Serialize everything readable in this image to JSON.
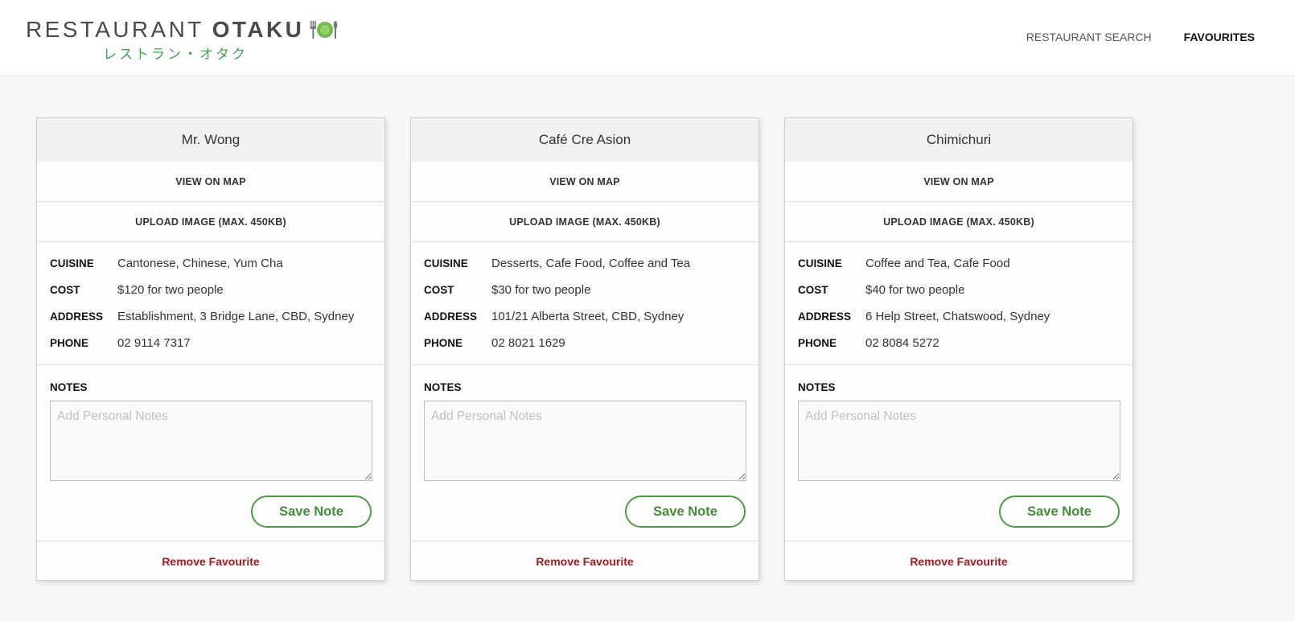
{
  "app": {
    "logo_light": "RESTAURANT",
    "logo_bold": "OTAKU",
    "logo_sub": "レストラン・オタク",
    "brand_green": "#3fa54a"
  },
  "nav": {
    "items": [
      {
        "label": "RESTAURANT SEARCH",
        "active": false
      },
      {
        "label": "FAVOURITES",
        "active": true
      }
    ]
  },
  "labels": {
    "view_on_map": "VIEW ON MAP",
    "upload_image": "UPLOAD IMAGE (MAX. 450KB)",
    "cuisine": "CUISINE",
    "cost": "COST",
    "address": "ADDRESS",
    "phone": "PHONE",
    "notes": "NOTES",
    "notes_placeholder": "Add Personal Notes",
    "save_note": "Save Note",
    "remove_favourite": "Remove Favourite"
  },
  "favourites": [
    {
      "name": "Mr. Wong",
      "cuisine": "Cantonese, Chinese, Yum Cha",
      "cost": "$120 for two people",
      "address": "Establishment, 3 Bridge Lane, CBD, Sydney",
      "phone": "02 9114 7317",
      "notes": ""
    },
    {
      "name": "Café Cre Asion",
      "cuisine": "Desserts, Cafe Food, Coffee and Tea",
      "cost": "$30 for two people",
      "address": "101/21 Alberta Street, CBD, Sydney",
      "phone": "02 8021 1629",
      "notes": ""
    },
    {
      "name": "Chimichuri",
      "cuisine": "Coffee and Tea, Cafe Food",
      "cost": "$40 for two people",
      "address": "6 Help Street, Chatswood, Sydney",
      "phone": "02 8084 5272",
      "notes": ""
    }
  ]
}
